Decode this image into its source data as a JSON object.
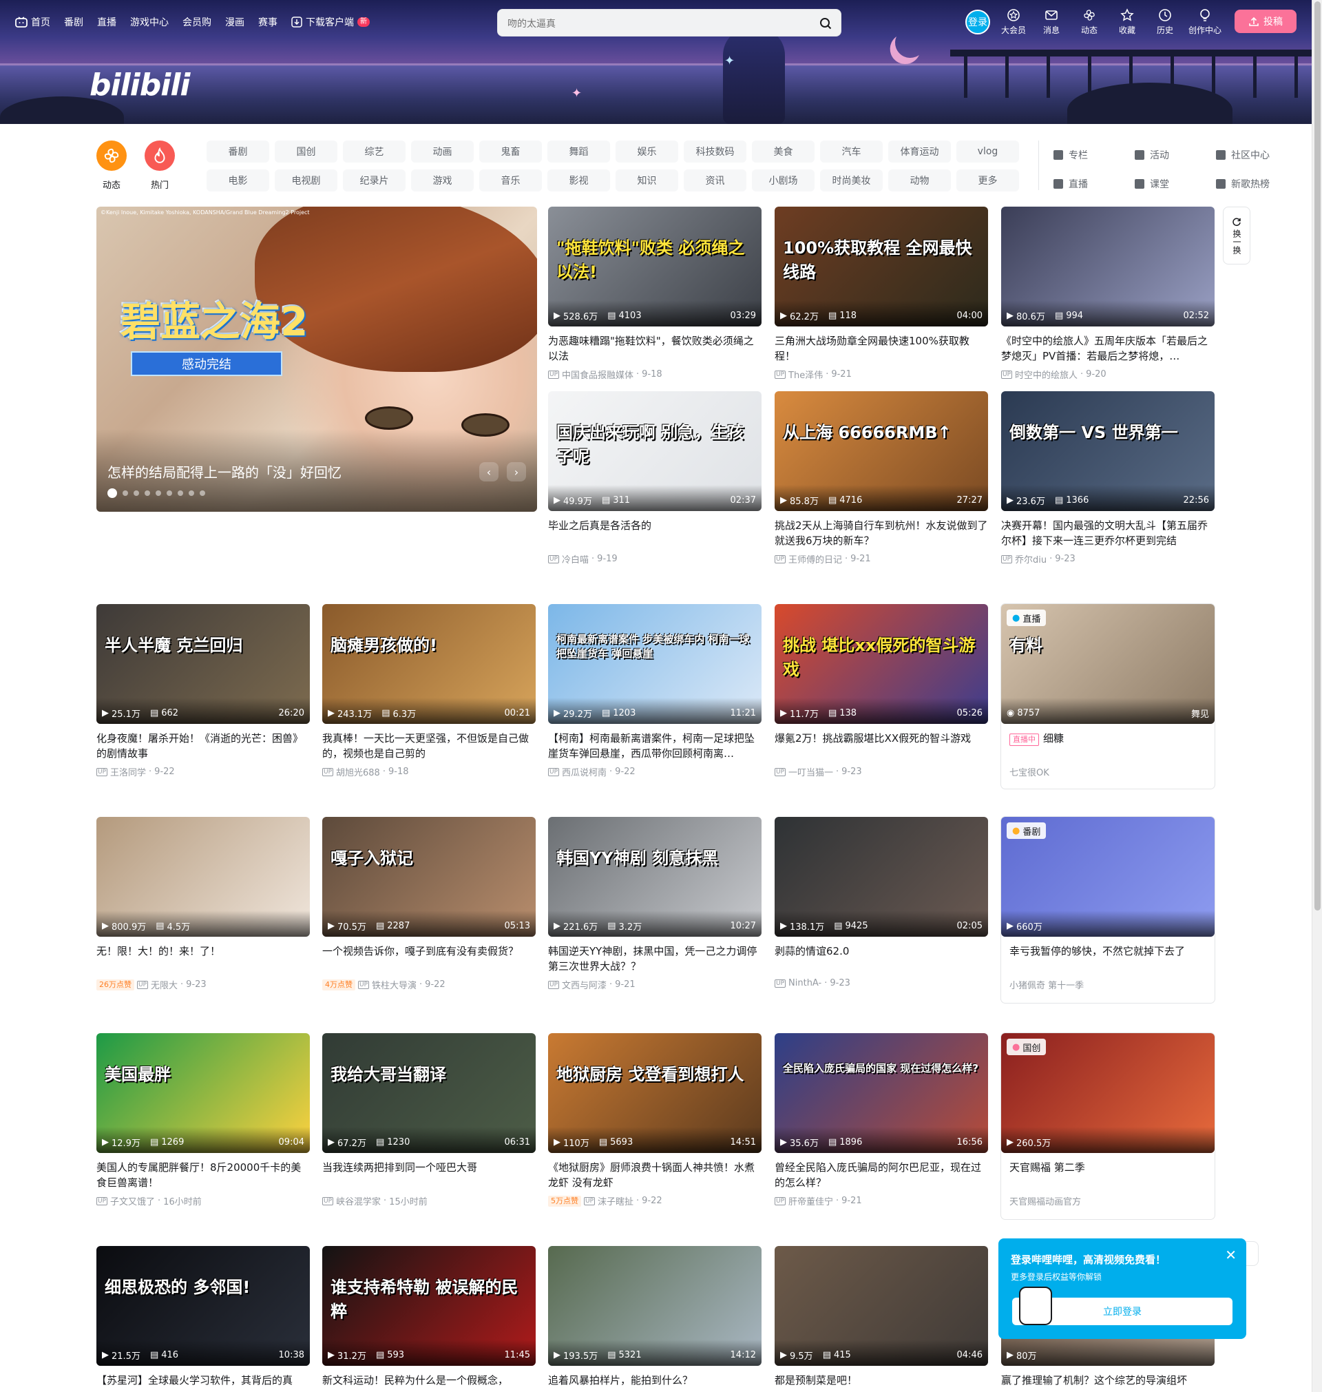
{
  "nav": {
    "home": "首页",
    "bangumi": "番剧",
    "live": "直播",
    "game_center": "游戏中心",
    "vip_shop": "会员购",
    "manga": "漫画",
    "match": "赛事",
    "download": "下载客户端",
    "download_badge": "新"
  },
  "search": {
    "placeholder": "吻的太逼真"
  },
  "userbar": {
    "login": "登录",
    "vip": "大会员",
    "messages": "消息",
    "dynamics": "动态",
    "favorites": "收藏",
    "history": "历史",
    "creator": "创作中心",
    "upload": "投稿"
  },
  "logo": "bilibili",
  "channels": {
    "dynamic": "动态",
    "hot": "热门",
    "chips": [
      "番剧",
      "国创",
      "综艺",
      "动画",
      "鬼畜",
      "舞蹈",
      "娱乐",
      "科技数码",
      "美食",
      "汽车",
      "体育运动",
      "vlog",
      "电影",
      "电视剧",
      "纪录片",
      "游戏",
      "音乐",
      "影视",
      "知识",
      "资讯",
      "小剧场",
      "时尚美妆",
      "动物",
      "更多"
    ],
    "links": [
      "专栏",
      "活动",
      "社区中心",
      "直播",
      "课堂",
      "新歌热榜"
    ]
  },
  "hero": {
    "caption": "怎样的结局配得上一路的「没」好回忆",
    "logo_text": "碧蓝之海2",
    "ribbon": "感动完结",
    "copyright": "©Kenji Inoue, Kimitake Yoshioka, KODANSHA/Grand Blue Dreaming2 Project"
  },
  "refresh": "换一换",
  "videos": [
    {
      "views": "528.6万",
      "danmaku": "4103",
      "duration": "03:29",
      "title": "为恶趣味糟蹋\"拖鞋饮料\"，餐饮败类必须绳之以法",
      "up": "中国食品报融媒体",
      "date": "9-18",
      "overlay": "\"拖鞋饮料\"败类 必须绳之以法!"
    },
    {
      "views": "62.2万",
      "danmaku": "118",
      "duration": "04:00",
      "title": "三角洲大战场勋章全网最快速100%获取教程！",
      "up": "The泽伟",
      "date": "9-21",
      "overlay": "100%获取教程 全网最快线路"
    },
    {
      "views": "80.6万",
      "danmaku": "994",
      "duration": "02:52",
      "title": "《时空中的绘旅人》五周年庆版本「若最后之梦熄灭」PV首播：若最后之梦将熄，…",
      "up": "时空中的绘旅人",
      "date": "9-20",
      "overlay": ""
    },
    {
      "views": "49.9万",
      "danmaku": "311",
      "duration": "02:37",
      "title": "毕业之后真是各活各的",
      "up": "冷白喵",
      "date": "9-19",
      "overlay": "国庆出来玩啊 别急，生孩子呢"
    },
    {
      "views": "85.8万",
      "danmaku": "4716",
      "duration": "27:27",
      "title": "挑战2天从上海骑自行车到杭州！水友说做到了就送我6万块的新车？",
      "up": "王师傅的日记",
      "date": "9-21",
      "overlay": "从上海 66666RMB↑"
    },
    {
      "views": "23.6万",
      "danmaku": "1366",
      "duration": "22:56",
      "title": "决赛开幕！国内最强的文明大乱斗【第五届乔尔杯】接下来一连三更乔尔杯更到完结",
      "up": "乔尔diu",
      "date": "9-23",
      "overlay": "倒数第一 VS 世界第一"
    },
    {
      "views": "25.1万",
      "danmaku": "662",
      "duration": "26:20",
      "title": "化身夜魔！屠杀开始！《消逝的光芒：困兽》的剧情故事",
      "up": "王洛同学",
      "date": "9-22",
      "overlay": "半人半魔 克兰回归"
    },
    {
      "views": "243.1万",
      "danmaku": "6.3万",
      "duration": "00:21",
      "title": "我真棒！一天比一天更坚强，不但饭是自己做的，视频也是自己剪的",
      "up": "胡旭光688",
      "date": "9-18",
      "overlay": "脑瘫男孩做的!"
    },
    {
      "views": "29.2万",
      "danmaku": "1203",
      "duration": "11:21",
      "title": "【柯南】柯南最新离谱案件，柯南一足球把坠崖货车弹回悬崖，西瓜带你回顾柯南离…",
      "up": "西瓜说柯南",
      "date": "9-22",
      "overlay": "柯南最新离谱案件 步美被绑车内 柯南一球把坠崖货车 弹回悬崖"
    },
    {
      "views": "11.7万",
      "danmaku": "138",
      "duration": "05:26",
      "title": "爆氪2万！挑战霸服堪比XX假死的智斗游戏",
      "up": "一叮当猫一",
      "date": "9-23",
      "overlay": "挑战 堪比xx假死的智斗游戏"
    },
    {
      "views": "8757",
      "title": "细糠",
      "up": "七宝很OK",
      "live_tag": "直播中",
      "top_tag": "直播",
      "corner": "舞见",
      "overlay": "有料"
    },
    {
      "views": "800.9万",
      "danmaku": "4.5万",
      "duration": "",
      "title": "无！限！大！的！来！了！",
      "up": "无限大",
      "date": "9-23",
      "likes": "26万点赞"
    },
    {
      "views": "70.5万",
      "danmaku": "2287",
      "duration": "05:13",
      "title": "一个视频告诉你，嘎子到底有没有卖假货？",
      "up": "铁柱大导演",
      "date": "9-22",
      "likes": "4万点赞",
      "overlay": "嘎子入狱记"
    },
    {
      "views": "221.6万",
      "danmaku": "3.2万",
      "duration": "10:27",
      "title": "韩国逆天YY神剧，抹黑中国，凭一己之力调停第三次世界大战？？",
      "up": "文西与阿漆",
      "date": "9-21",
      "overlay": "韩国YY神剧 刻意抹黑"
    },
    {
      "views": "138.1万",
      "danmaku": "9425",
      "duration": "02:05",
      "title": "剥蒜的情谊62.0",
      "up": "NinthA-",
      "date": "9-23"
    },
    {
      "views": "660万",
      "title": "幸亏我暂停的够快，不然它就掉下去了",
      "up": "小猪佩奇 第十一季",
      "top_tag": "番剧"
    },
    {
      "views": "12.9万",
      "danmaku": "1269",
      "duration": "09:04",
      "title": "美国人的专属肥胖餐厅！8斤20000千卡的美食巨兽离谱！",
      "up": "子文又饿了",
      "date": "16小时前",
      "overlay": "美国最胖"
    },
    {
      "views": "67.2万",
      "danmaku": "1230",
      "duration": "06:31",
      "title": "当我连续两把排到同一个哑巴大哥",
      "up": "峡谷混学家",
      "date": "15小时前",
      "overlay": "我给大哥当翻译"
    },
    {
      "views": "110万",
      "danmaku": "5693",
      "duration": "14:51",
      "title": "《地狱厨房》厨师浪费十锅面人神共愤！水煮龙虾 没有龙虾",
      "up": "沫子瞎扯",
      "date": "9-22",
      "likes": "5万点赞",
      "overlay": "地狱厨房 戈登看到想打人"
    },
    {
      "views": "35.6万",
      "danmaku": "1896",
      "duration": "16:56",
      "title": "曾经全民陷入庞氏骗局的阿尔巴尼亚，现在过的怎么样？",
      "up": "肝帝董佳宁",
      "date": "9-21",
      "overlay": "全民陷入庞氏骗局的国家 现在过得怎么样?"
    },
    {
      "views": "260.5万",
      "title": "天官赐福 第二季",
      "up": "天官赐福动画官方",
      "top_tag": "国创"
    },
    {
      "views": "21.5万",
      "danmaku": "416",
      "duration": "10:38",
      "title": "【苏星河】全球最火学习软件，其背后的真",
      "overlay": "细思极恐的 多邻国!"
    },
    {
      "views": "31.2万",
      "danmaku": "593",
      "duration": "11:45",
      "title": "新文科运动！民粹为什么是一个假概念，",
      "overlay": "谁支持希特勒 被误解的民粹"
    },
    {
      "views": "193.5万",
      "danmaku": "5321",
      "duration": "14:12",
      "title": "追着风暴拍样片，能拍到什么？"
    },
    {
      "views": "9.5万",
      "danmaku": "415",
      "duration": "04:46",
      "title": "都是预制菜是吧！"
    },
    {
      "views": "80万",
      "title": "赢了推理输了机制？这个综艺的导演组坏"
    }
  ],
  "popup": {
    "title": "登录哔哩哔哩，高清视频免费看！",
    "subtitle": "更多登录后权益等你解锁",
    "button": "立即登录"
  }
}
